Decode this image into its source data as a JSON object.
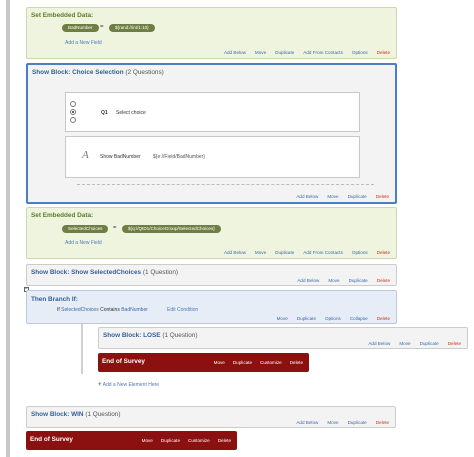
{
  "colors": {
    "accent": "#4a7fc1",
    "end_of_survey": "#8b1010",
    "embedded": "#eef4dd",
    "branch": "#e6edf7",
    "delete": "#c8331d"
  },
  "embedded1": {
    "title": "Set Embedded Data:",
    "field": "BadNumber",
    "eq": "=",
    "value": "${rand://int/1:10}",
    "add_field": "Add a New Field",
    "actions": [
      "Add Below",
      "Move",
      "Duplicate",
      "Add From Contacts",
      "Options",
      "Delete"
    ]
  },
  "block_choice": {
    "title": "Show Block: Choice Selection",
    "count": "(2 Questions)",
    "q1": {
      "id": "Q1",
      "text": "Select choice"
    },
    "q2": {
      "icon": "A",
      "text": "Show BadNumber",
      "pipe": "${e://Field/BadNumber}"
    },
    "actions": [
      "Add Below",
      "Move",
      "Duplicate",
      "Delete"
    ]
  },
  "embedded2": {
    "title": "Set Embedded Data:",
    "field": "SelectedChoices",
    "eq": "=",
    "value": "${q://QID1/ChoiceGroup/SelectedChoices}",
    "add_field": "Add a New Field",
    "actions": [
      "Add Below",
      "Move",
      "Duplicate",
      "Add From Contacts",
      "Options",
      "Delete"
    ]
  },
  "block_selected": {
    "title": "Show Block: Show SelectedChoices",
    "count": "(1 Question)",
    "actions": [
      "Add Below",
      "Move",
      "Duplicate",
      "Delete"
    ]
  },
  "branch": {
    "toggle": "−",
    "title": "Then Branch If:",
    "cond_if": "If",
    "cond_field": "SelectedChoices",
    "cond_op": "Contains",
    "cond_value": "BadNumber",
    "edit": "Edit Condition",
    "actions": [
      "Move",
      "Duplicate",
      "Options",
      "Collapse",
      "Delete"
    ]
  },
  "block_lose": {
    "title": "Show Block: LOSE",
    "count": "(1 Question)",
    "actions": [
      "Add Below",
      "Move",
      "Duplicate",
      "Delete"
    ]
  },
  "eos1": {
    "title": "End of Survey",
    "actions": [
      "Move",
      "Duplicate",
      "Customize",
      "Delete"
    ]
  },
  "add_element": {
    "plus": "+",
    "label": "Add a New Element Here"
  },
  "block_win": {
    "title": "Show Block: WIN",
    "count": "(1 Question)",
    "actions": [
      "Add Below",
      "Move",
      "Duplicate",
      "Delete"
    ]
  },
  "eos2": {
    "title": "End of Survey",
    "actions": [
      "Move",
      "Duplicate",
      "Customize",
      "Delete"
    ]
  }
}
